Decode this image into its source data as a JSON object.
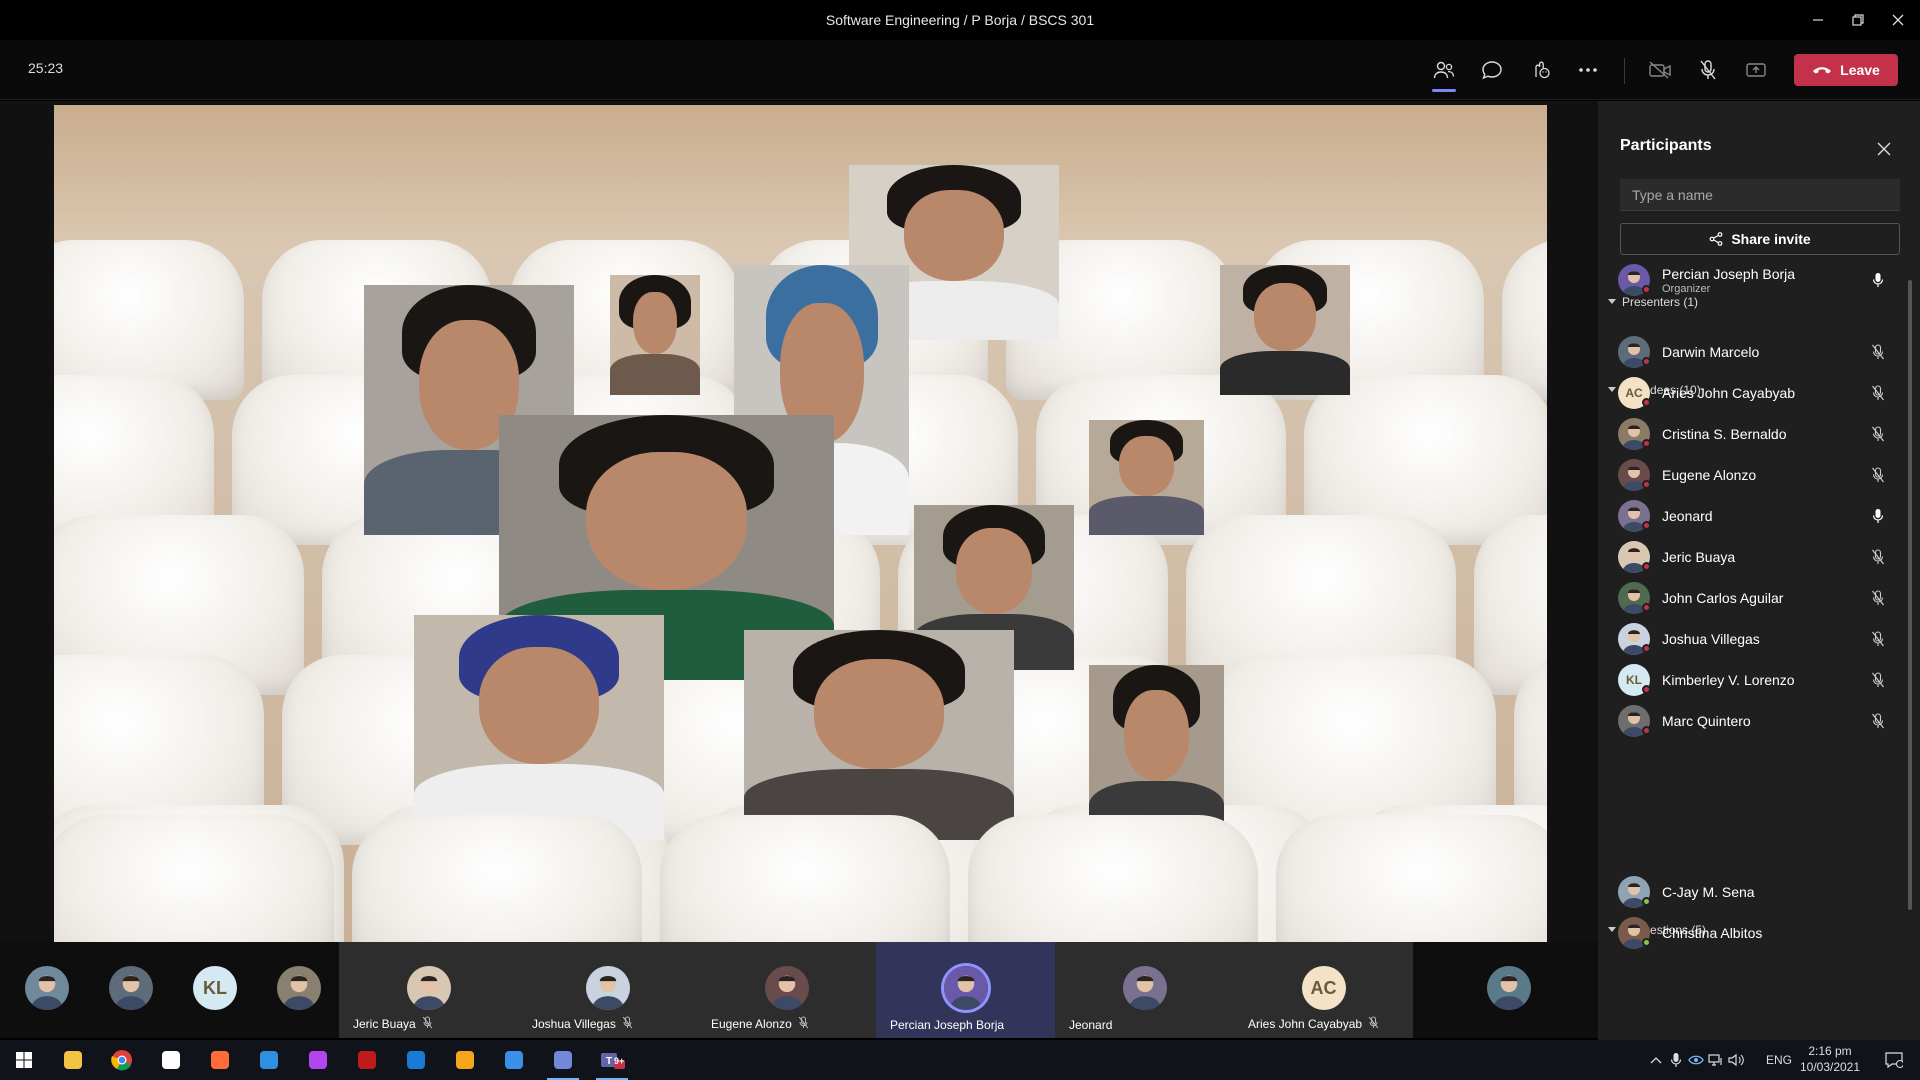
{
  "window": {
    "title": "Software Engineering / P Borja / BSCS 301"
  },
  "toolbar": {
    "timer": "25:23",
    "leave_label": "Leave",
    "icons": [
      "people-icon",
      "chat-icon",
      "reactions-icon",
      "more-icon",
      "camera-off-icon",
      "mic-off-icon",
      "share-tray-icon"
    ]
  },
  "panel": {
    "title": "Participants",
    "search_placeholder": "Type a name",
    "share_invite_label": "Share invite",
    "presenters_header": "Presenters (1)",
    "presenters": [
      {
        "name": "Percian Joseph Borja",
        "role": "Organizer",
        "mic": "on",
        "avatar_color": "#6a58a8"
      }
    ],
    "attendees_header": "Attendees (10)",
    "attendees": [
      {
        "name": "Darwin Marcelo",
        "mic": "off",
        "avatar_color": "#5e6b78"
      },
      {
        "name": "Aries John Cayabyab",
        "initials": "AC",
        "mic": "off",
        "avatar_color": "#f3e2c6"
      },
      {
        "name": "Cristina S. Bernaldo",
        "mic": "off",
        "avatar_color": "#8a7a66"
      },
      {
        "name": "Eugene Alonzo",
        "mic": "off",
        "avatar_color": "#6a4b4b"
      },
      {
        "name": "Jeonard",
        "mic": "on",
        "avatar_color": "#7a7090"
      },
      {
        "name": "Jeric Buaya",
        "mic": "off",
        "avatar_color": "#d8c7b2"
      },
      {
        "name": "John Carlos Aguilar",
        "mic": "off",
        "avatar_color": "#4f6b4f"
      },
      {
        "name": "Joshua Villegas",
        "mic": "off",
        "avatar_color": "#c9d3e0"
      },
      {
        "name": "Kimberley V. Lorenzo",
        "initials": "KL",
        "mic": "off",
        "avatar_color": "#d5e9f2"
      },
      {
        "name": "Marc Quintero",
        "mic": "off",
        "avatar_color": "#6e6e6e"
      }
    ],
    "suggestions_header": "Suggestions (5)",
    "suggestions": [
      {
        "name": "C-Jay M. Sena",
        "avatar_color": "#8fa3b5"
      },
      {
        "name": "Christina Albitos",
        "avatar_color": "#7a5a4a"
      }
    ]
  },
  "strip": {
    "small_tiles": [
      {
        "avatar_color": "#6f8a9a"
      },
      {
        "avatar_color": "#5e6b78"
      },
      {
        "initials": "KL",
        "avatar_color": "#d5e9f2"
      },
      {
        "avatar_color": "#8a8070"
      }
    ],
    "labeled_tiles": [
      {
        "name": "Jeric Buaya",
        "muted": true,
        "avatar_color": "#d8c7b2"
      },
      {
        "name": "Joshua Villegas",
        "muted": true,
        "avatar_color": "#c9d3e0"
      },
      {
        "name": "Eugene Alonzo",
        "muted": true,
        "avatar_color": "#6a4b4b"
      },
      {
        "name": "Percian Joseph Borja",
        "muted": false,
        "avatar_color": "#6a58a8",
        "selected": true
      },
      {
        "name": "Jeonard",
        "muted": false,
        "avatar_color": "#7a7090"
      },
      {
        "name": "Aries John Cayabyab",
        "initials": "AC",
        "muted": true,
        "avatar_color": "#f3e2c6"
      }
    ],
    "last_tile": {
      "avatar_color": "#5a7a8a"
    }
  },
  "taskbar": {
    "apps": [
      "windows-start-icon",
      "file-explorer-icon",
      "chrome-icon",
      "app-icon",
      "postman-icon",
      "vscode-icon",
      "phpstorm-icon",
      "filezilla-icon",
      "steam-icon",
      "app-orange-icon",
      "v-app-icon",
      "discord-icon",
      "teams-icon"
    ],
    "language": "ENG",
    "time": "2:16 pm",
    "date": "10/03/2021",
    "teams_badge": "9+"
  }
}
